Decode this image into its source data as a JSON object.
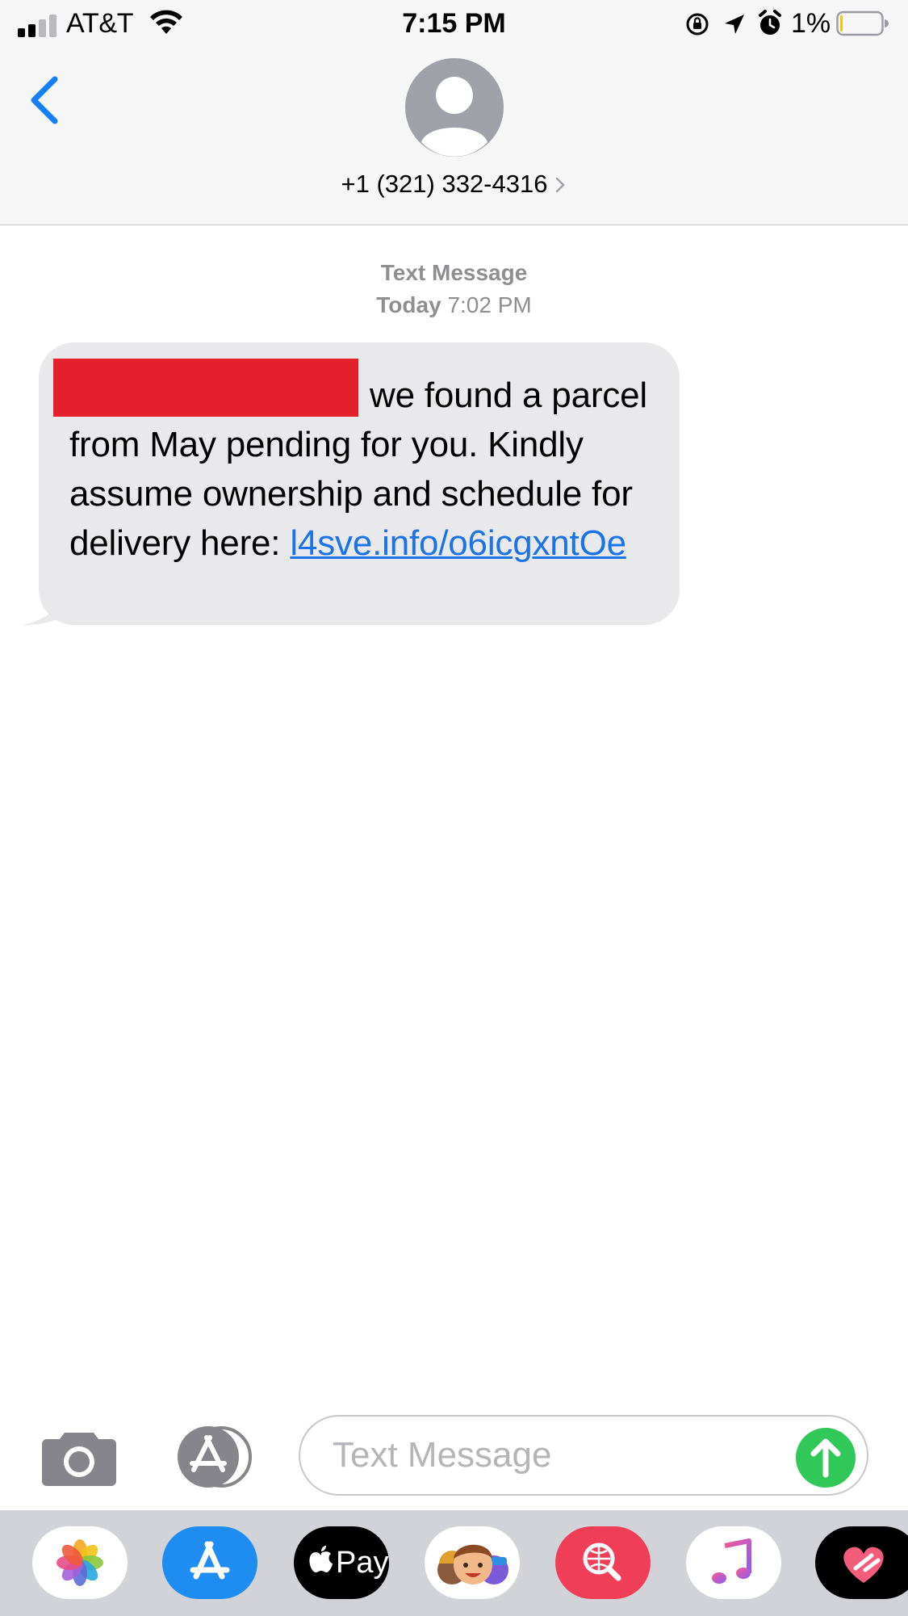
{
  "status_bar": {
    "carrier": "AT&T",
    "time": "7:15 PM",
    "battery_percent": "1%",
    "signal_bars": 2,
    "battery_level": 0.01,
    "icons": [
      "signal-icon",
      "wifi-icon",
      "rotation-lock-icon",
      "location-icon",
      "alarm-icon",
      "battery-icon"
    ]
  },
  "header": {
    "back_icon": "chevron-left-icon",
    "avatar_icon": "person-icon",
    "contact": "+1 (321) 332-4316",
    "contact_chevron": ">"
  },
  "conversation": {
    "service": "Text Message",
    "day": "Today",
    "time": "7:02 PM",
    "messages": [
      {
        "direction": "incoming",
        "redacted": true,
        "text": "we found a parcel from May pending for you. Kindly assume ownership and schedule for delivery here:",
        "link": "l4sve.info/o6icgxntOe"
      }
    ]
  },
  "input_bar": {
    "camera_icon": "camera-icon",
    "apps_icon": "app-store-icon",
    "placeholder": "Text Message",
    "value": "",
    "send_icon": "send-arrow-icon"
  },
  "app_drawer": {
    "apps": [
      {
        "name": "photos-app-icon"
      },
      {
        "name": "app-store-app-icon"
      },
      {
        "name": "apple-pay-app-icon",
        "label": "Pay"
      },
      {
        "name": "memoji-app-icon"
      },
      {
        "name": "web-search-app-icon"
      },
      {
        "name": "music-app-icon"
      },
      {
        "name": "digital-touch-app-icon"
      }
    ]
  },
  "colors": {
    "accent_blue": "#1a73e8",
    "incoming_bubble": "#e9e9eb",
    "send_green": "#32c759",
    "redaction_red": "#e5202d"
  }
}
